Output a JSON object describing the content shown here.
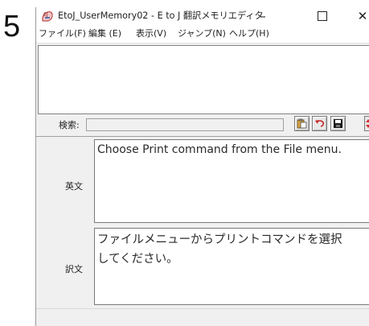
{
  "step": {
    "number": "5"
  },
  "window": {
    "title": "EtoJ_UserMemory02 - E to J 翻訳メモリエディタ",
    "controls": {
      "minimize": "–",
      "close": "✕"
    }
  },
  "menu": {
    "items": [
      {
        "label": "ファイル(F)"
      },
      {
        "label": "編集 (E)"
      },
      {
        "label": "表示(V)"
      },
      {
        "label": "ジャンプ(N)"
      },
      {
        "label": "ヘルプ(H)"
      }
    ]
  },
  "search": {
    "label": "検索:",
    "value": ""
  },
  "toolbar": {
    "icons": [
      "paste-icon",
      "undo-icon",
      "save-icon",
      "spin-icon"
    ],
    "colors": {
      "disk": "#1a1a1a",
      "undo": "#c62828",
      "spin": "#d32f2f"
    }
  },
  "entry": {
    "english_label": "英文",
    "english_text": "Choose Print command from the File menu.",
    "japanese_label": "訳文",
    "japanese_lines": [
      "ファイルメニューからプリントコマンドを選択",
      "してください。"
    ]
  }
}
